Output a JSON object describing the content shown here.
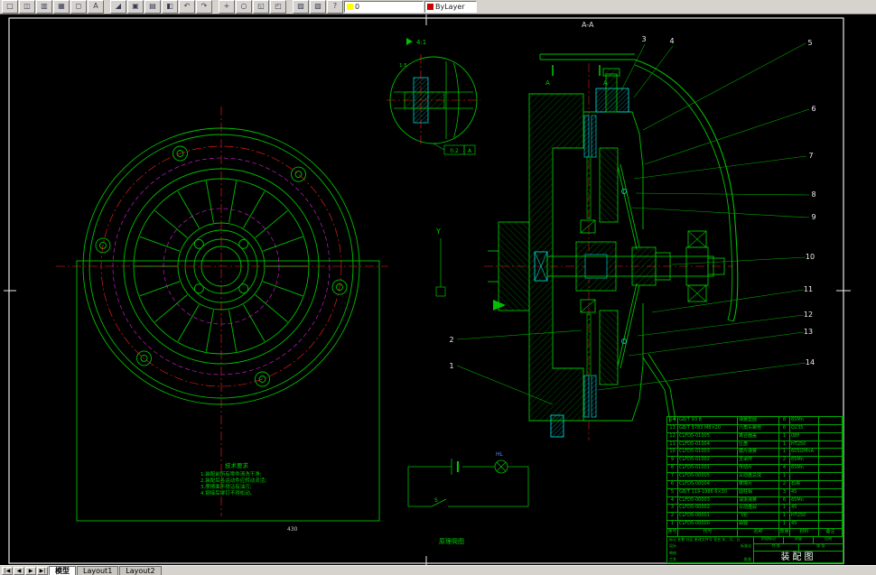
{
  "app": {
    "toolbar_icons": [
      {
        "name": "new-icon",
        "glyph": "□"
      },
      {
        "name": "open-icon",
        "glyph": "◫"
      },
      {
        "name": "save-icon",
        "glyph": "▥"
      },
      {
        "name": "print-icon",
        "glyph": "▦"
      },
      {
        "name": "preview-icon",
        "glyph": "◻"
      },
      {
        "name": "spell-icon",
        "glyph": "A"
      },
      {
        "name": "separator",
        "glyph": ""
      },
      {
        "name": "cut-icon",
        "glyph": "◢"
      },
      {
        "name": "copy-icon",
        "glyph": "▣"
      },
      {
        "name": "paste-icon",
        "glyph": "▤"
      },
      {
        "name": "match-props-icon",
        "glyph": "◧"
      },
      {
        "name": "undo-icon",
        "glyph": "↶"
      },
      {
        "name": "redo-icon",
        "glyph": "↷"
      },
      {
        "name": "separator",
        "glyph": ""
      },
      {
        "name": "pan-icon",
        "glyph": "+"
      },
      {
        "name": "zoom-realtime-icon",
        "glyph": "○"
      },
      {
        "name": "zoom-window-icon",
        "glyph": "◱"
      },
      {
        "name": "zoom-previous-icon",
        "glyph": "◰"
      },
      {
        "name": "separator",
        "glyph": ""
      },
      {
        "name": "properties-icon",
        "glyph": "▨"
      },
      {
        "name": "design-center-icon",
        "glyph": "▧"
      },
      {
        "name": "help-icon",
        "glyph": "?"
      }
    ],
    "layer_combo_value": "0",
    "color_combo_value": "ByLayer"
  },
  "tabs": {
    "nav": [
      "|◀",
      "◀",
      "▶",
      "▶|"
    ],
    "model": "模型",
    "layout1": "Layout1",
    "layout2": "Layout2"
  },
  "drawing": {
    "section_label": "A-A",
    "detail_scale": "4:1",
    "detail_dim": "1.5",
    "tolerance_value": "0.2",
    "tolerance_datum": "A",
    "axis_label": "Y",
    "cut_label": "A",
    "dim_bottom": "430",
    "balloons": [
      "1",
      "2",
      "3",
      "4",
      "5",
      "6",
      "7",
      "8",
      "9",
      "10",
      "11",
      "12",
      "13",
      "14"
    ],
    "schematic": {
      "caption": "原理简图",
      "lamp_label": "HL",
      "switch_label": "S"
    },
    "tech": {
      "title": "技术要求",
      "lines": [
        "1.装配前所有零件清洗干净;",
        "2.装配后各运动件应转动灵活;",
        "3.摩擦面不得沾有油污;",
        "4.铆接后铆钉不得松动。"
      ]
    }
  },
  "parts_table": {
    "header": {
      "seq": "序号",
      "code": "代号",
      "name": "名称",
      "qty": "数量",
      "material": "材料",
      "remark": "备注"
    },
    "rows": [
      {
        "seq": "14",
        "code": "GB/T 93  8",
        "name": "弹簧垫圈",
        "qty": "8",
        "material": "65Mn",
        "remark": ""
      },
      {
        "seq": "13",
        "code": "GB/T 5783 M8×20",
        "name": "六角头螺栓",
        "qty": "8",
        "material": "Q235",
        "remark": ""
      },
      {
        "seq": "12",
        "code": "CLFD5-01005",
        "name": "离合器盖",
        "qty": "1",
        "material": "08F",
        "remark": ""
      },
      {
        "seq": "11",
        "code": "CLFD5-01004",
        "name": "压盘",
        "qty": "1",
        "material": "HT250",
        "remark": ""
      },
      {
        "seq": "10",
        "code": "CLFD5-01003",
        "name": "膜片弹簧",
        "qty": "1",
        "material": "60Si2MnA",
        "remark": ""
      },
      {
        "seq": "9",
        "code": "CLFD5-01002",
        "name": "支承环",
        "qty": "2",
        "material": "65Mn",
        "remark": ""
      },
      {
        "seq": "8",
        "code": "CLFD5-01001",
        "name": "传动片",
        "qty": "4",
        "material": "65Mn",
        "remark": ""
      },
      {
        "seq": "7",
        "code": "CLFD5-00005",
        "name": "从动盘总成",
        "qty": "1",
        "material": "",
        "remark": ""
      },
      {
        "seq": "6",
        "code": "CLFD5-00004",
        "name": "摩擦片",
        "qty": "2",
        "material": "石棉",
        "remark": ""
      },
      {
        "seq": "5",
        "code": "GB/T 119-1986 6×30",
        "name": "圆柱销",
        "qty": "3",
        "material": "45",
        "remark": ""
      },
      {
        "seq": "4",
        "code": "CLFD5-00003",
        "name": "减振弹簧",
        "qty": "6",
        "material": "65Mn",
        "remark": ""
      },
      {
        "seq": "3",
        "code": "CLFD5-00002",
        "name": "从动盘毂",
        "qty": "1",
        "material": "45",
        "remark": ""
      },
      {
        "seq": "2",
        "code": "CLFD5-00001",
        "name": "飞轮",
        "qty": "1",
        "material": "HT250",
        "remark": ""
      },
      {
        "seq": "1",
        "code": "CLFD5-00000",
        "name": "曲轴",
        "qty": "1",
        "material": "45",
        "remark": ""
      }
    ]
  },
  "title_block": {
    "title": "装配图",
    "top_line": "标记 处数 分区 更改文件号 签名 年、月、日",
    "roles": [
      "设计",
      "审核",
      "工艺",
      "标准化",
      "批准"
    ],
    "stage": "阶段标记",
    "mass": "质量",
    "scale": "比例",
    "sheets": "共 张",
    "sheet_no": "第 张"
  }
}
